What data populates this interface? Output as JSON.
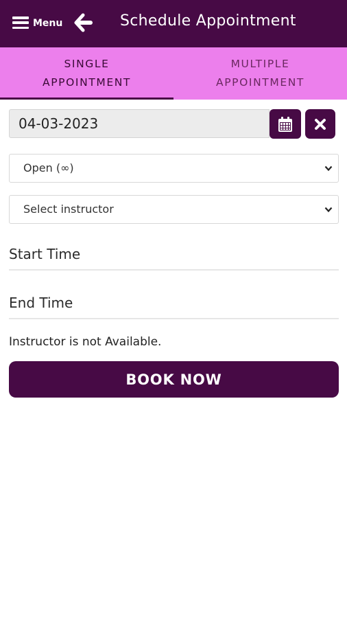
{
  "header": {
    "menu_label": "Menu",
    "title": "Schedule Appointment",
    "icons": [
      "hamburger-icon",
      "back-arrow-icon"
    ]
  },
  "tabs": [
    {
      "line1": "SINGLE",
      "line2": "APPOINTMENT",
      "active": true
    },
    {
      "line1": "MULTIPLE",
      "line2": "APPOINTMENT",
      "active": false
    }
  ],
  "form": {
    "date_value": "04-03-2023",
    "status_selected": "Open (∞)",
    "instructor_selected": "Select instructor",
    "start_time_label": "Start Time",
    "end_time_label": "End Time",
    "availability_message": "Instructor is not Available.",
    "book_label": "BOOK NOW"
  },
  "colors": {
    "primary": "#470a45",
    "tab_bar": "#ec7fec",
    "input_bg": "#ececec",
    "background": "#ffffff"
  }
}
